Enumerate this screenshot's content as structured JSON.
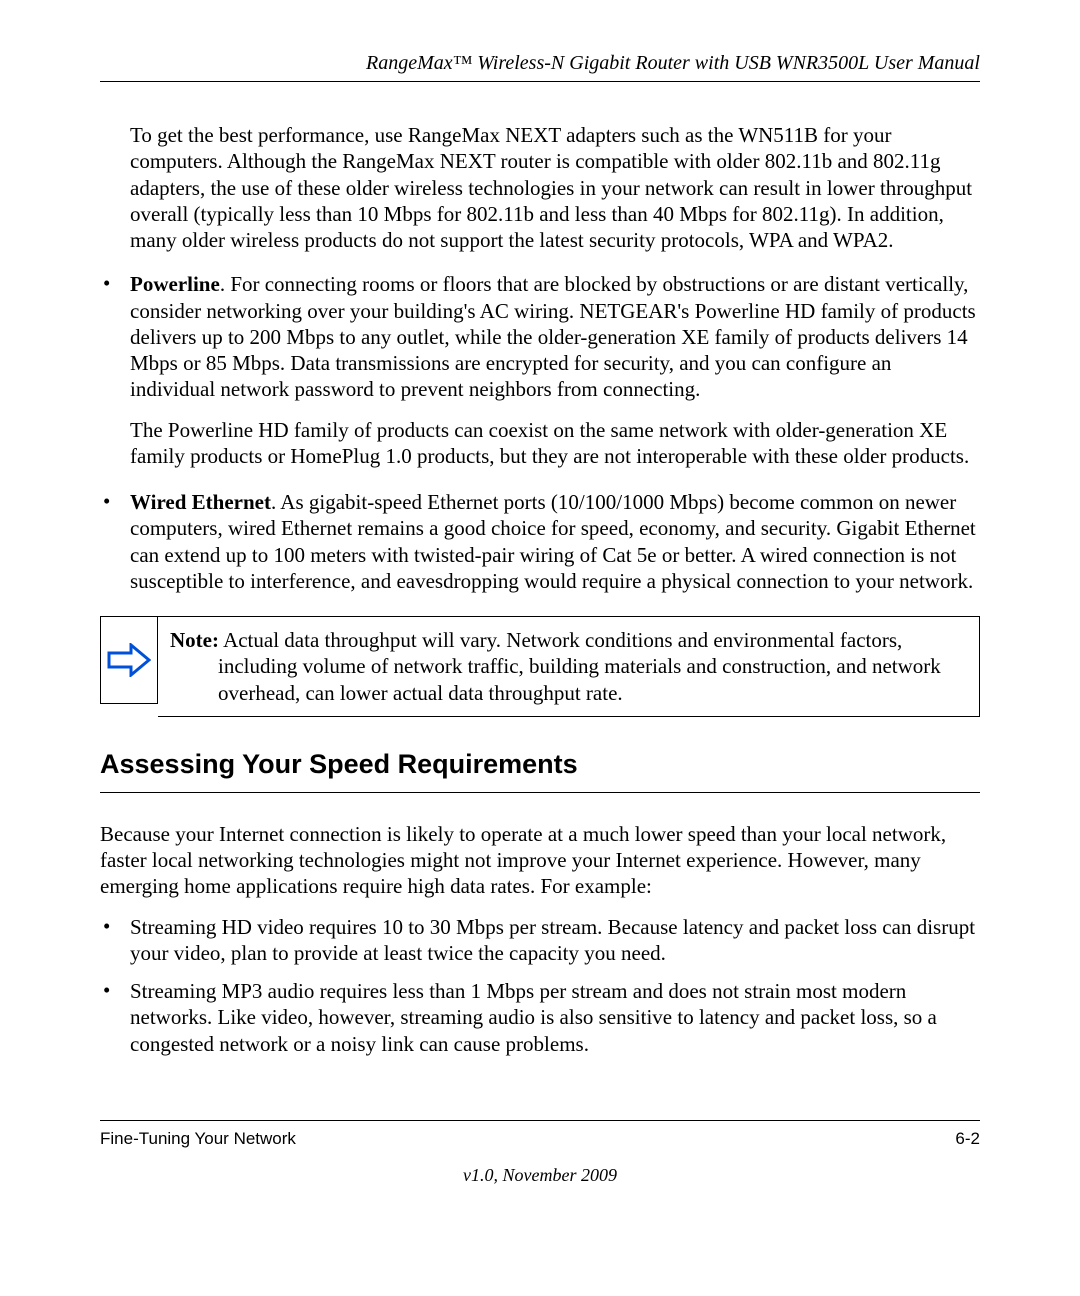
{
  "header": {
    "title": "RangeMax™ Wireless-N Gigabit Router with USB WNR3500L User Manual"
  },
  "intro_para": "To get the best performance, use RangeMax NEXT adapters such as the WN511B for your computers. Although the RangeMax NEXT router is compatible with older 802.11b and 802.11g adapters, the use of these older wireless technologies in your network can result in lower throughput overall (typically less than 10 Mbps for 802.11b and less than 40 Mbps for 802.11g). In addition, many older wireless products do not support the latest security protocols, WPA and WPA2.",
  "bullets": {
    "powerline": {
      "lead": "Powerline",
      "text": ". For connecting rooms or floors that are blocked by obstructions or are distant vertically, consider networking over your building's AC wiring. NETGEAR's Powerline HD family of products delivers up to 200 Mbps to any outlet, while the older-generation XE family of products delivers 14 Mbps or 85 Mbps. Data transmissions are encrypted for security, and you can configure an individual network password to prevent neighbors from connecting.",
      "sub": "The Powerline HD family of products can coexist on the same network with older-generation XE family products or HomePlug 1.0 products, but they are not interoperable with these older products."
    },
    "wired": {
      "lead": "Wired Ethernet",
      "text": ". As gigabit-speed Ethernet ports (10/100/1000 Mbps) become common on newer computers, wired Ethernet remains a good choice for speed, economy, and security. Gigabit Ethernet can extend up to 100 meters with twisted-pair wiring of Cat 5e or better. A wired connection is not susceptible to interference, and eavesdropping would require a physical connection to your network."
    }
  },
  "note": {
    "label": "Note:",
    "first_line": " Actual data throughput will vary. Network conditions and environmental factors,",
    "cont": "including volume of network traffic, building materials and construction, and network overhead, can lower actual data throughput rate."
  },
  "section": {
    "heading": "Assessing Your Speed Requirements",
    "para": "Because your Internet connection is likely to operate at a much lower speed than your local network, faster local networking technologies might not improve your Internet experience. However, many emerging home applications require high data rates. For example:",
    "items": {
      "hd": "Streaming HD video requires 10 to 30 Mbps per stream. Because latency and packet loss can disrupt your video, plan to provide at least twice the capacity you need.",
      "mp3": "Streaming MP3 audio requires less than 1 Mbps per stream and does not strain most modern networks. Like video, however, streaming audio is also sensitive to latency and packet loss, so a congested network or a noisy link can cause problems."
    }
  },
  "footer": {
    "left": "Fine-Tuning Your Network",
    "right": "6-2",
    "center": "v1.0, November 2009"
  }
}
